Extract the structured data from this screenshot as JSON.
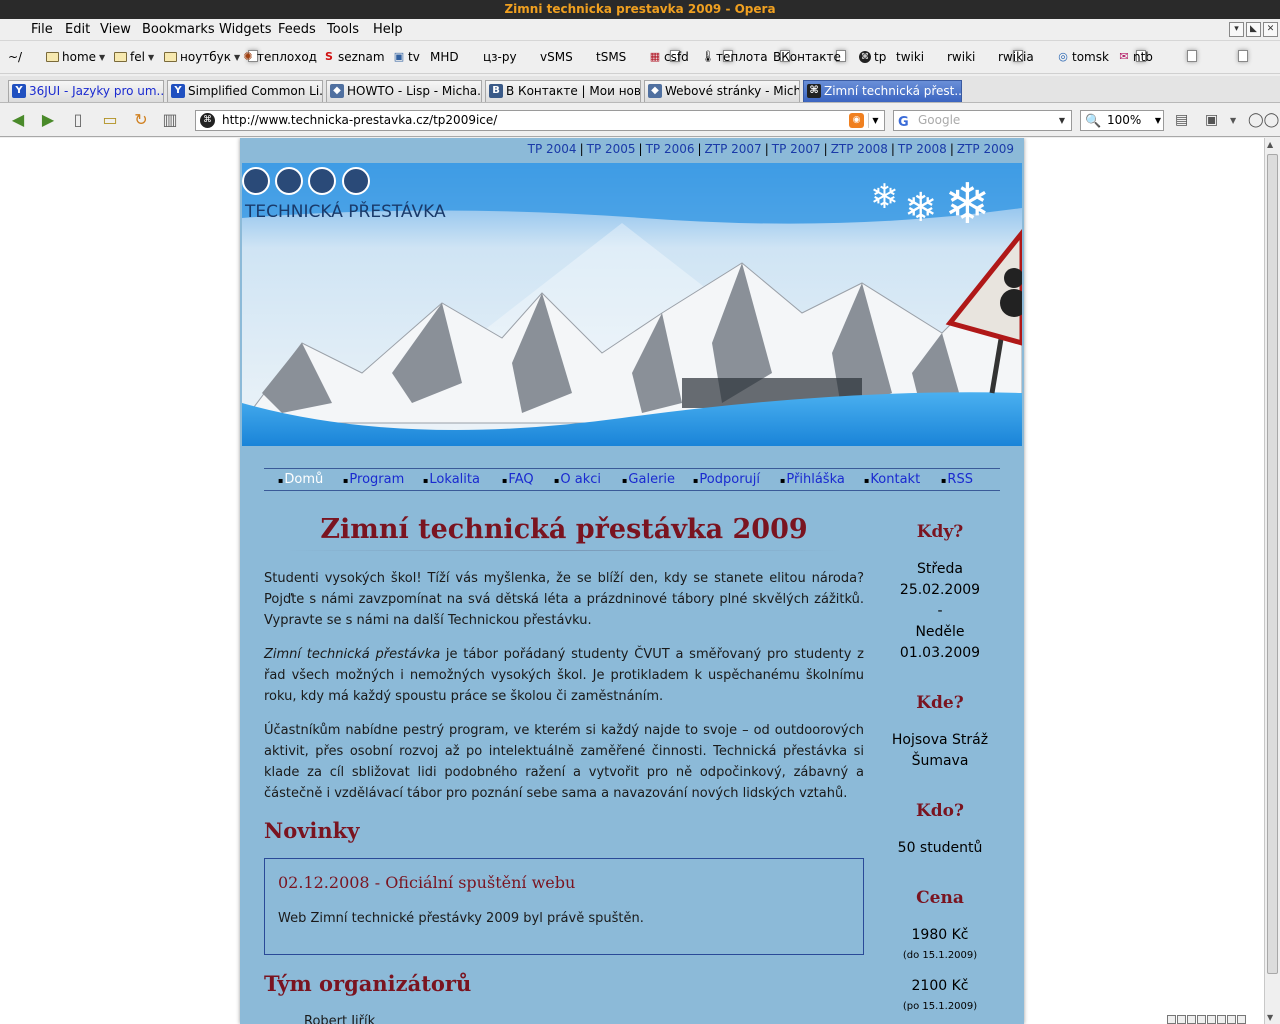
{
  "window": {
    "title": "Zimni technicka prestavka 2009 - Opera"
  },
  "menubar": {
    "items": [
      "File",
      "Edit",
      "View",
      "Bookmarks",
      "Widgets",
      "Feeds",
      "Tools",
      "Help"
    ]
  },
  "bookmarks": [
    {
      "label": "~/",
      "icon": "page-icon"
    },
    {
      "label": "home",
      "icon": "folder-icon"
    },
    {
      "label": "fel",
      "icon": "folder-icon"
    },
    {
      "label": "ноутбук",
      "icon": "folder-icon"
    },
    {
      "label": "теплоход",
      "icon": "sun-icon"
    },
    {
      "label": "seznam",
      "icon": "s-icon"
    },
    {
      "label": "tv",
      "icon": "tv-icon"
    },
    {
      "label": "MHD",
      "icon": "page-icon"
    },
    {
      "label": "цз-ру",
      "icon": "page-icon"
    },
    {
      "label": "vSMS",
      "icon": "page-icon"
    },
    {
      "label": "tSMS",
      "icon": "page-icon"
    },
    {
      "label": "csfd",
      "icon": "csfd-icon"
    },
    {
      "label": "теплота",
      "icon": "thermometer-icon"
    },
    {
      "label": "ВКонтакте",
      "icon": "page-icon"
    },
    {
      "label": "tp",
      "icon": "tp-icon"
    },
    {
      "label": "twiki",
      "icon": "page-icon"
    },
    {
      "label": "rwiki",
      "icon": "page-icon"
    },
    {
      "label": "rwikia",
      "icon": "page-icon"
    },
    {
      "label": "tomsk",
      "icon": "ring-icon"
    },
    {
      "label": "ntb",
      "icon": "mail-icon"
    }
  ],
  "tabs": [
    {
      "label": "36JUI - Jazyky pro um...",
      "active": false
    },
    {
      "label": "Simplified Common Li...",
      "active": false
    },
    {
      "label": "HOWTO - Lisp - Micha...",
      "active": false
    },
    {
      "label": "В Контакте | Мои нов...",
      "active": false
    },
    {
      "label": "Webové stránky - Mich...",
      "active": false
    },
    {
      "label": "Zimní technická přest...",
      "active": true
    }
  ],
  "address": {
    "url": "http://www.technicka-prestavka.cz/tp2009ice/",
    "search_placeholder": "Google",
    "zoom": "100%"
  },
  "page": {
    "year_links": [
      "TP 2004",
      "TP 2005",
      "TP 2006",
      "ZTP 2007",
      "TP 2007",
      "ZTP 2008",
      "TP 2008",
      "ZTP 2009"
    ],
    "logo_text": "TECHNICKÁ PŘESTÁVKA",
    "nav": [
      "Domů",
      "Program",
      "Lokalita",
      "FAQ",
      "O akci",
      "Galerie",
      "Podporují",
      "Přihláška",
      "Kontakt",
      "RSS"
    ],
    "title": "Zimní technická přestávka 2009",
    "para1": "Studenti vysokých škol! Tíží vás myšlenka, že se blíží den, kdy se stanete elitou národa? Pojďte s námi zavzpomínat na svá dětská léta a prázdninové tábory plné skvělých zážitků. Vypravte se s námi na další Technickou přestávku.",
    "para2_em": "Zimní technická přestávka",
    "para2_rest": " je tábor pořádaný studenty ČVUT a směřovaný pro studenty z řad všech možných i nemožných vysokých škol. Je protikladem k uspěchanému školnímu roku, kdy má každý spoustu práce se školou či zaměstnáním.",
    "para3": "Účastníkům nabídne pestrý program, ve kterém si každý najde to svoje – od outdoorových aktivit, přes osobní rozvoj až po intelektuálně zaměřené činnosti. Technická přestávka si klade za cíl sbližovat lidi podobného ražení a vytvořit pro ně odpočinkový, zábavný a částečně i vzdělávací tábor pro poznání sebe sama a navazování nových lidských vztahů.",
    "news_heading": "Novinky",
    "news_title": "02.12.2008 - Oficiální spuštění webu",
    "news_body": "Web Zimní technické přestávky 2009 byl právě spuštěn.",
    "team_heading": "Tým organizátorů",
    "team_first": "Robert Jiřík"
  },
  "sidebar": {
    "when_h": "Kdy?",
    "when_day1": "Středa",
    "when_date1": "25.02.2009",
    "when_dash": "-",
    "when_day2": "Neděle",
    "when_date2": "01.03.2009",
    "where_h": "Kde?",
    "where_1": "Hojsova Stráž",
    "where_2": "Šumava",
    "who_h": "Kdo?",
    "who_v": "50 studentů",
    "price_h": "Cena",
    "price1": "1980 Kč",
    "price1_note": "(do 15.1.2009)",
    "price2": "2100 Kč",
    "price2_note": "(po 15.1.2009)"
  }
}
